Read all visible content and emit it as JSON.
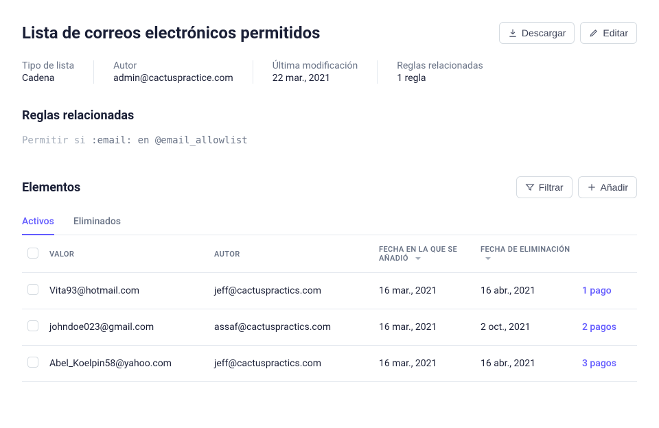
{
  "header": {
    "title": "Lista de correos electrónicos permitidos",
    "download_label": "Descargar",
    "edit_label": "Editar"
  },
  "meta": {
    "list_type_label": "Tipo de lista",
    "list_type_value": "Cadena",
    "author_label": "Autor",
    "author_value": "admin@cactuspractice.com",
    "modified_label": "Última modificación",
    "modified_value": "22 mar., 2021",
    "rules_label": "Reglas relacionadas",
    "rules_value": "1 regla"
  },
  "related_rules": {
    "title": "Reglas relacionadas",
    "code_prefix": "Permitir si ",
    "code_body": ":email: en @email_allowlist"
  },
  "elements": {
    "title": "Elementos",
    "filter_label": "Filtrar",
    "add_label": "Añadir",
    "tabs": {
      "active": "Activos",
      "removed": "Eliminados"
    },
    "columns": {
      "valor": "VALOR",
      "autor": "AUTOR",
      "added": "FECHA EN LA QUE SE AÑADIÓ",
      "removed": "FECHA DE ELIMINACIÓN"
    },
    "rows": [
      {
        "valor": "Vita93@hotmail.com",
        "autor": "jeff@cactuspractics.com",
        "added": "16 mar., 2021",
        "removed": "16 abr., 2021",
        "payments": "1 pago"
      },
      {
        "valor": "johndoe023@gmail.com",
        "autor": "assaf@cactuspractics.com",
        "added": "16 mar., 2021",
        "removed": "2 oct., 2021",
        "payments": "2 pagos"
      },
      {
        "valor": "Abel_Koelpin58@yahoo.com",
        "autor": "jeff@cactuspractics.com",
        "added": "16 mar., 2021",
        "removed": "16 abr., 2021",
        "payments": "3 pagos"
      }
    ]
  }
}
